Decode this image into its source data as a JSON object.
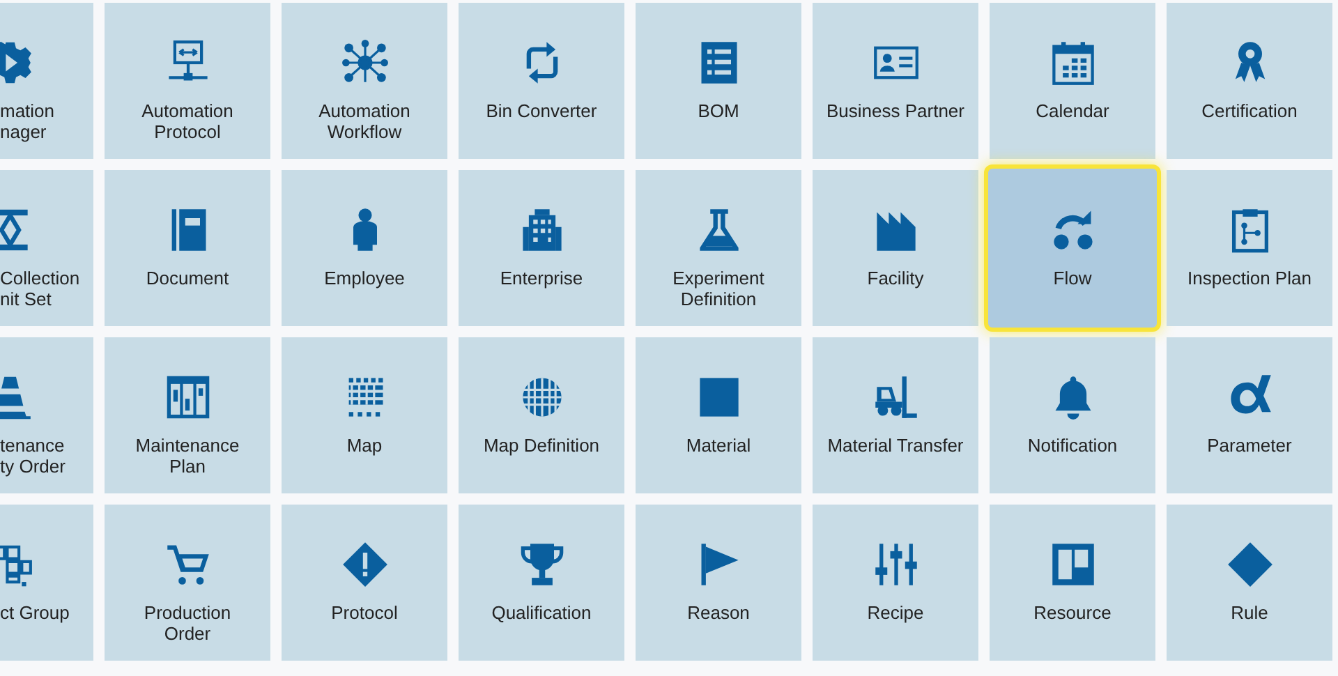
{
  "rows": [
    {
      "tiles": [
        {
          "lines": [
            "mation",
            "nager"
          ],
          "selected": false
        },
        {
          "lines": [
            "Automation",
            "Protocol"
          ],
          "selected": false
        },
        {
          "lines": [
            "Automation",
            "Workflow"
          ],
          "selected": false
        },
        {
          "lines": [
            "Bin Converter"
          ],
          "selected": false
        },
        {
          "lines": [
            "BOM"
          ],
          "selected": false
        },
        {
          "lines": [
            "Business Partner"
          ],
          "selected": false
        },
        {
          "lines": [
            "Calendar"
          ],
          "selected": false
        },
        {
          "lines": [
            "Certification"
          ],
          "selected": false
        }
      ]
    },
    {
      "tiles": [
        {
          "lines": [
            "Collection",
            "nit Set"
          ],
          "selected": false
        },
        {
          "lines": [
            "Document"
          ],
          "selected": false
        },
        {
          "lines": [
            "Employee"
          ],
          "selected": false
        },
        {
          "lines": [
            "Enterprise"
          ],
          "selected": false
        },
        {
          "lines": [
            "Experiment",
            "Definition"
          ],
          "selected": false
        },
        {
          "lines": [
            "Facility"
          ],
          "selected": false
        },
        {
          "lines": [
            "Flow"
          ],
          "selected": true
        },
        {
          "lines": [
            "Inspection Plan"
          ],
          "selected": false
        }
      ]
    },
    {
      "tiles": [
        {
          "lines": [
            "tenance",
            "ty Order"
          ],
          "selected": false
        },
        {
          "lines": [
            "Maintenance",
            "Plan"
          ],
          "selected": false
        },
        {
          "lines": [
            "Map"
          ],
          "selected": false
        },
        {
          "lines": [
            "Map Definition"
          ],
          "selected": false
        },
        {
          "lines": [
            "Material"
          ],
          "selected": false
        },
        {
          "lines": [
            "Material Transfer"
          ],
          "selected": false
        },
        {
          "lines": [
            "Notification"
          ],
          "selected": false
        },
        {
          "lines": [
            "Parameter"
          ],
          "selected": false
        }
      ]
    },
    {
      "tiles": [
        {
          "lines": [
            "ct Group"
          ],
          "selected": false
        },
        {
          "lines": [
            "Production",
            "Order"
          ],
          "selected": false
        },
        {
          "lines": [
            "Protocol"
          ],
          "selected": false
        },
        {
          "lines": [
            "Qualification"
          ],
          "selected": false
        },
        {
          "lines": [
            "Reason"
          ],
          "selected": false
        },
        {
          "lines": [
            "Recipe"
          ],
          "selected": false
        },
        {
          "lines": [
            "Resource"
          ],
          "selected": false
        },
        {
          "lines": [
            "Rule"
          ],
          "selected": false
        }
      ]
    }
  ]
}
